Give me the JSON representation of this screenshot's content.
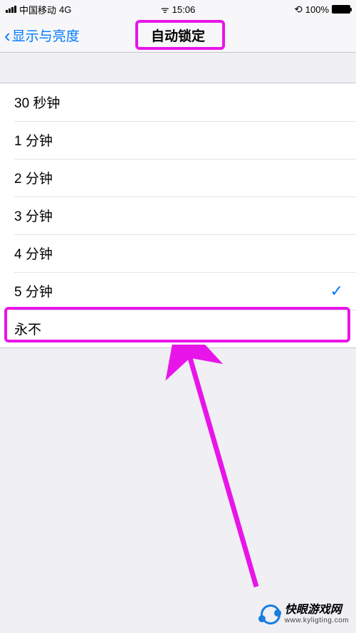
{
  "status": {
    "carrier": "中国移动",
    "network": "4G",
    "time": "15:06",
    "battery_pct": "100%"
  },
  "nav": {
    "back_label": "显示与亮度",
    "title": "自动锁定"
  },
  "options": [
    {
      "label": "30 秒钟",
      "selected": false
    },
    {
      "label": "1 分钟",
      "selected": false
    },
    {
      "label": "2 分钟",
      "selected": false
    },
    {
      "label": "3 分钟",
      "selected": false
    },
    {
      "label": "4 分钟",
      "selected": false
    },
    {
      "label": "5 分钟",
      "selected": true
    },
    {
      "label": "永不",
      "selected": false
    }
  ],
  "watermark": {
    "line1": "快眼游戏网",
    "line2": "www.kyligting.com"
  }
}
